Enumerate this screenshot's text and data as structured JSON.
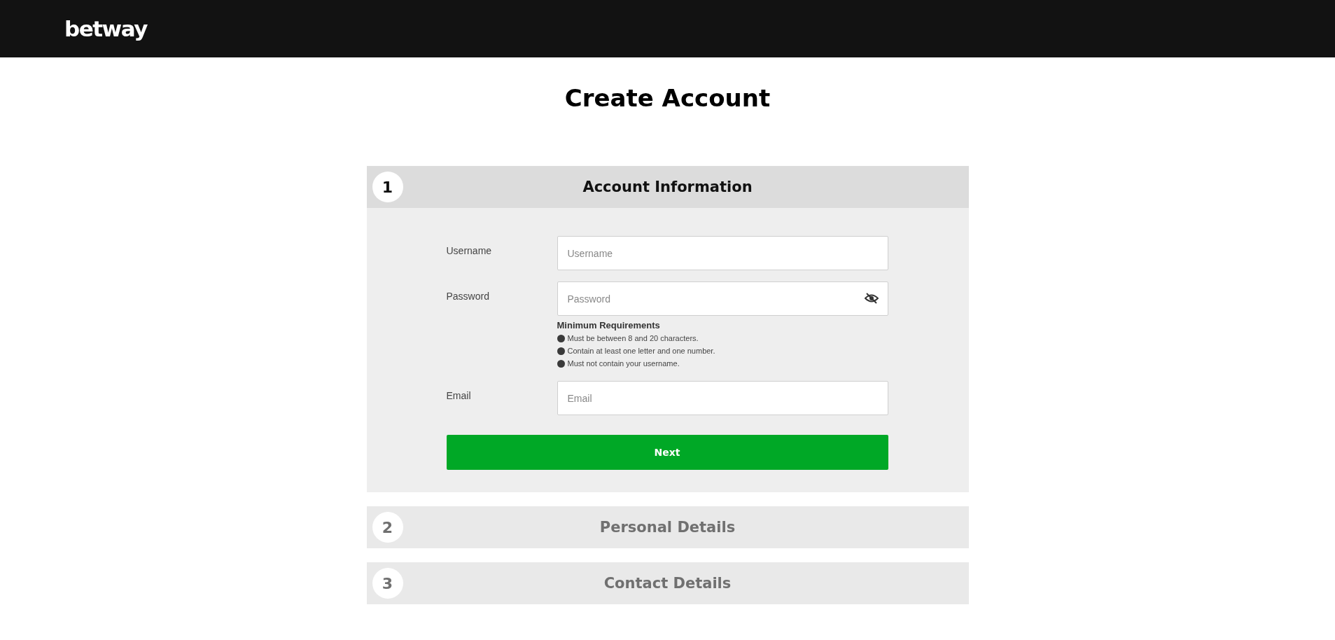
{
  "header": {
    "logo": "betway"
  },
  "page_title": "Create Account",
  "steps": [
    {
      "number": "1",
      "title": "Account Information",
      "expanded": true
    },
    {
      "number": "2",
      "title": "Personal Details",
      "expanded": false
    },
    {
      "number": "3",
      "title": "Contact Details",
      "expanded": false
    }
  ],
  "form": {
    "fields": [
      {
        "label": "Username",
        "placeholder": "Username",
        "kind": "text"
      },
      {
        "label": "Password",
        "placeholder": "Password",
        "kind": "password",
        "requirements_title": "Minimum Requirements",
        "requirements": [
          "Must be between 8 and 20 characters.",
          "Contain at least one letter and one number.",
          "Must not contain your username."
        ]
      },
      {
        "label": "Email",
        "placeholder": "Email",
        "kind": "text"
      }
    ],
    "submit": "Next"
  }
}
